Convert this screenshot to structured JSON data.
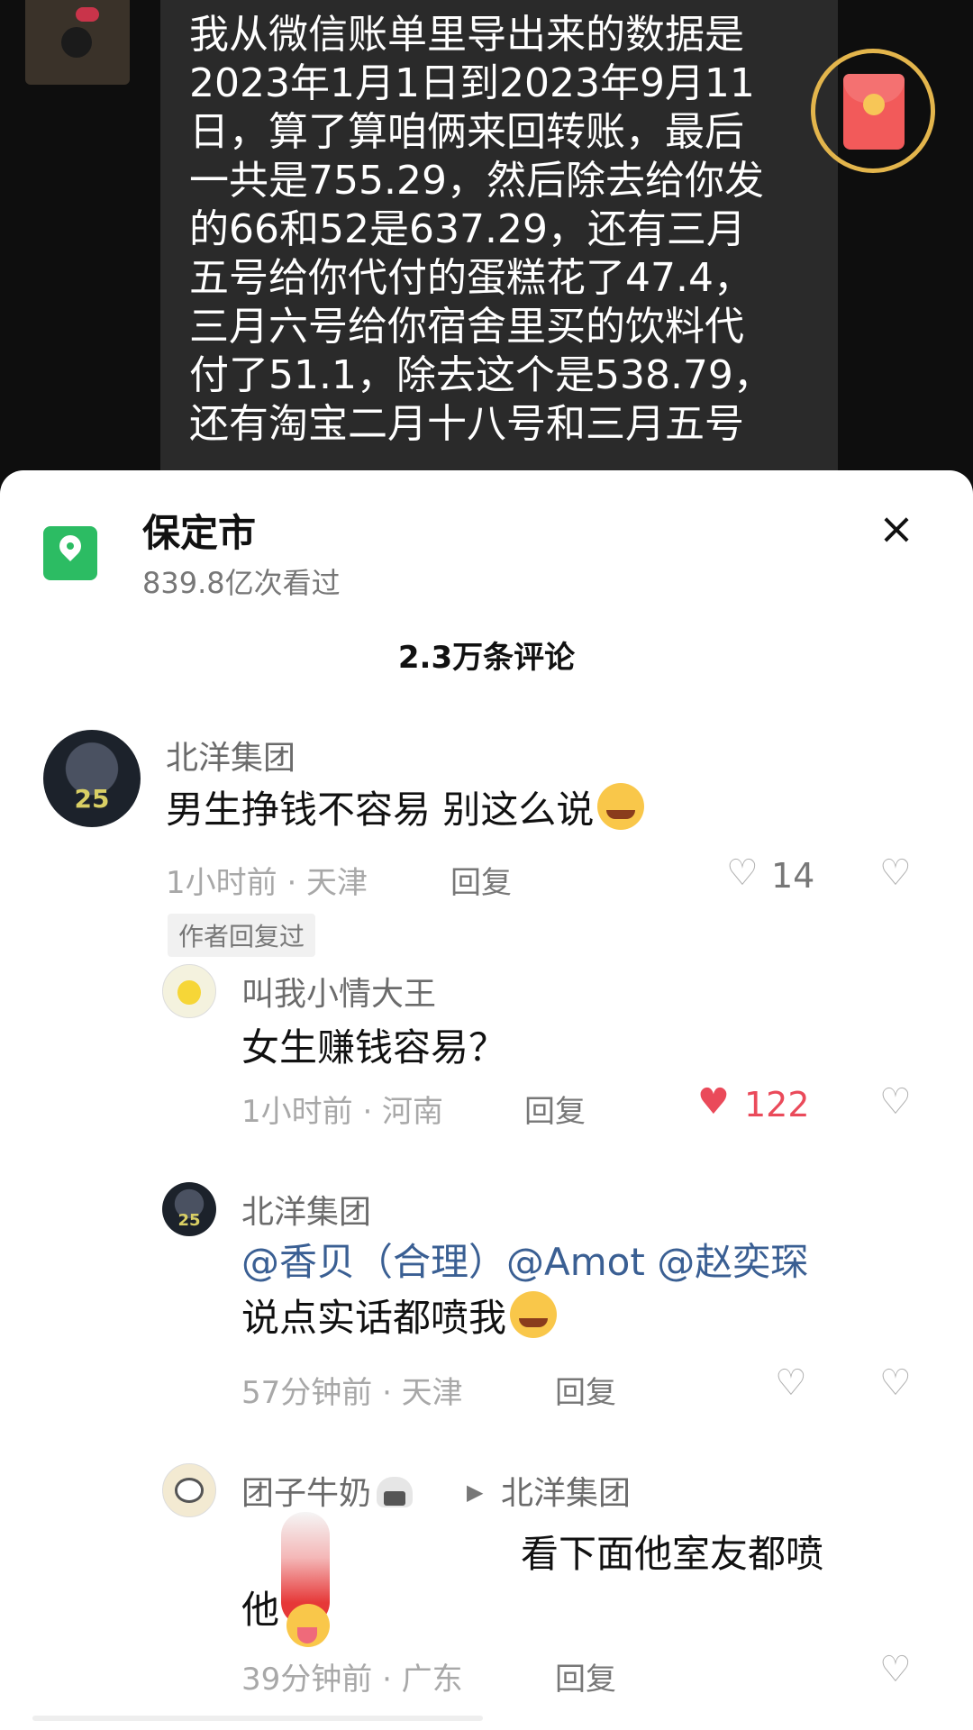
{
  "video": {
    "chat_text": "我从微信账单里导出来的数据是\n2023年1月1日到2023年9月11\n日，算了算咱俩来回转账，最后\n一共是755.29，然后除去给你发\n的66和52是637.29，还有三月\n五号给你代付的蛋糕花了47.4，\n三月六号给你宿舍里买的饮料代\n付了51.1，除去这个是538.79，\n还有淘宝二月十八号和三月五号"
  },
  "sheet": {
    "location_title": "保定市",
    "location_views": "839.8亿次看过",
    "close_icon": "×",
    "comment_count": "2.3万条评论"
  },
  "comments": [
    {
      "user": "北洋集团",
      "avatar_number": "25",
      "text": "男生挣钱不容易 别这么说",
      "meta": "1小时前 · 天津",
      "reply": "回复",
      "likes": "14",
      "author_tag": "作者回复过"
    },
    {
      "user": "叫我小情大王",
      "text": "女生赚钱容易？",
      "meta": "1小时前 · 河南",
      "reply": "回复",
      "likes": "122"
    },
    {
      "user": "北洋集团",
      "avatar_number": "25",
      "mention1": "@香贝（合理）",
      "mention2": "@Amot",
      "mention3": "@赵奕琛",
      "text": "说点实话都喷我",
      "meta": "57分钟前 · 天津",
      "reply": "回复"
    },
    {
      "user": "团子牛奶",
      "reply_to": "北洋集团",
      "text1": "看下面他室友都喷",
      "text2": "他",
      "meta": "39分钟前 · 广东",
      "reply": "回复"
    }
  ],
  "icons": {
    "heart": "♡",
    "heart_filled": "♥",
    "dislike": "♡",
    "arrow": "▶"
  },
  "colors": {
    "accent_green": "#2cbc63",
    "like_red": "#ea4a5a",
    "mention_blue": "#3a5f93"
  }
}
